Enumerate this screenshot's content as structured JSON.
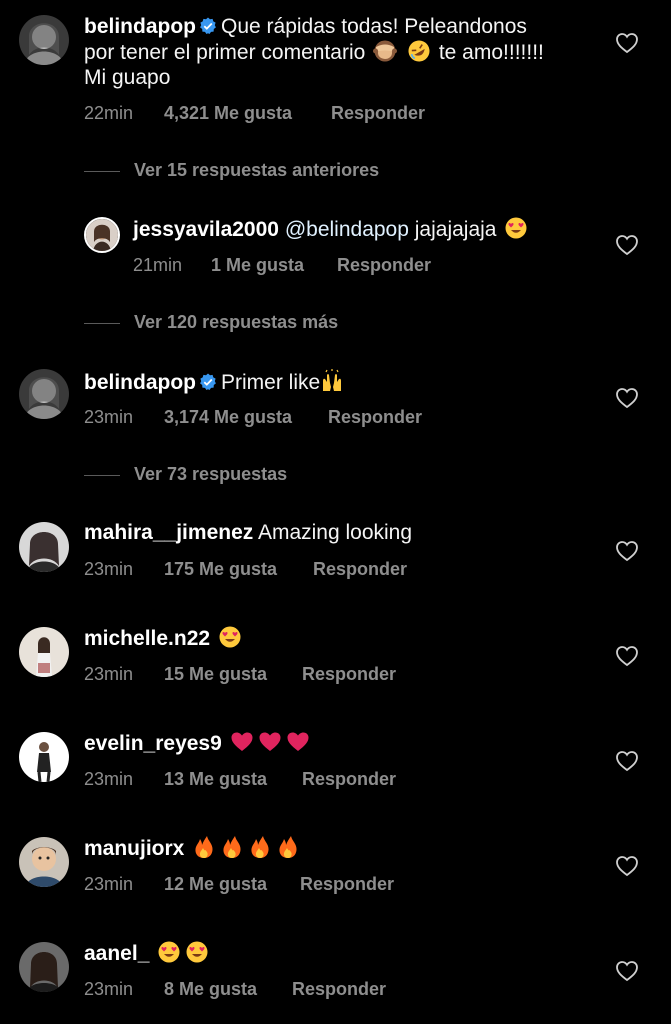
{
  "comments": [
    {
      "username": "belindapop",
      "verified": true,
      "text_lines": [
        "Que rápidas todas! Peleandonos",
        "por tener el primer comentario",
        "te amo!!!!!!!",
        "Mi guapo"
      ],
      "time": "22min",
      "likes": "4,321 Me gusta",
      "reply": "Responder"
    },
    {
      "username": "jessyavila2000",
      "mention": "@belindapop",
      "text": "jajajajaja",
      "time": "21min",
      "likes": "1 Me gusta",
      "reply": "Responder"
    },
    {
      "username": "belindapop",
      "verified": true,
      "text": "Primer like",
      "time": "23min",
      "likes": "3,174 Me gusta",
      "reply": "Responder"
    },
    {
      "username": "mahira__jimenez",
      "text": "Amazing looking",
      "time": "23min",
      "likes": "175 Me gusta",
      "reply": "Responder"
    },
    {
      "username": "michelle.n22",
      "time": "23min",
      "likes": "15 Me gusta",
      "reply": "Responder"
    },
    {
      "username": "evelin_reyes9",
      "time": "23min",
      "likes": "13 Me gusta",
      "reply": "Responder"
    },
    {
      "username": "manujiorx",
      "time": "23min",
      "likes": "12 Me gusta",
      "reply": "Responder"
    },
    {
      "username": "aanel_",
      "time": "23min",
      "likes": "8 Me gusta",
      "reply": "Responder"
    }
  ],
  "threads": {
    "previous_replies": "Ver 15 respuestas anteriores",
    "more_replies": "Ver 120 respuestas más",
    "view_replies": "Ver 73 respuestas"
  },
  "colors": {
    "background": "#000000",
    "text": "#ffffff",
    "secondary": "#8e8e8e",
    "verified": "#3897f0",
    "emoji_heart": "#e0245e"
  },
  "icons": [
    "verified-badge-icon",
    "heart-outline-icon",
    "monkey-see-no-evil-emoji",
    "rofl-emoji",
    "heart-eyes-emoji",
    "raising-hands-emoji",
    "red-heart-emoji",
    "fire-emoji"
  ]
}
